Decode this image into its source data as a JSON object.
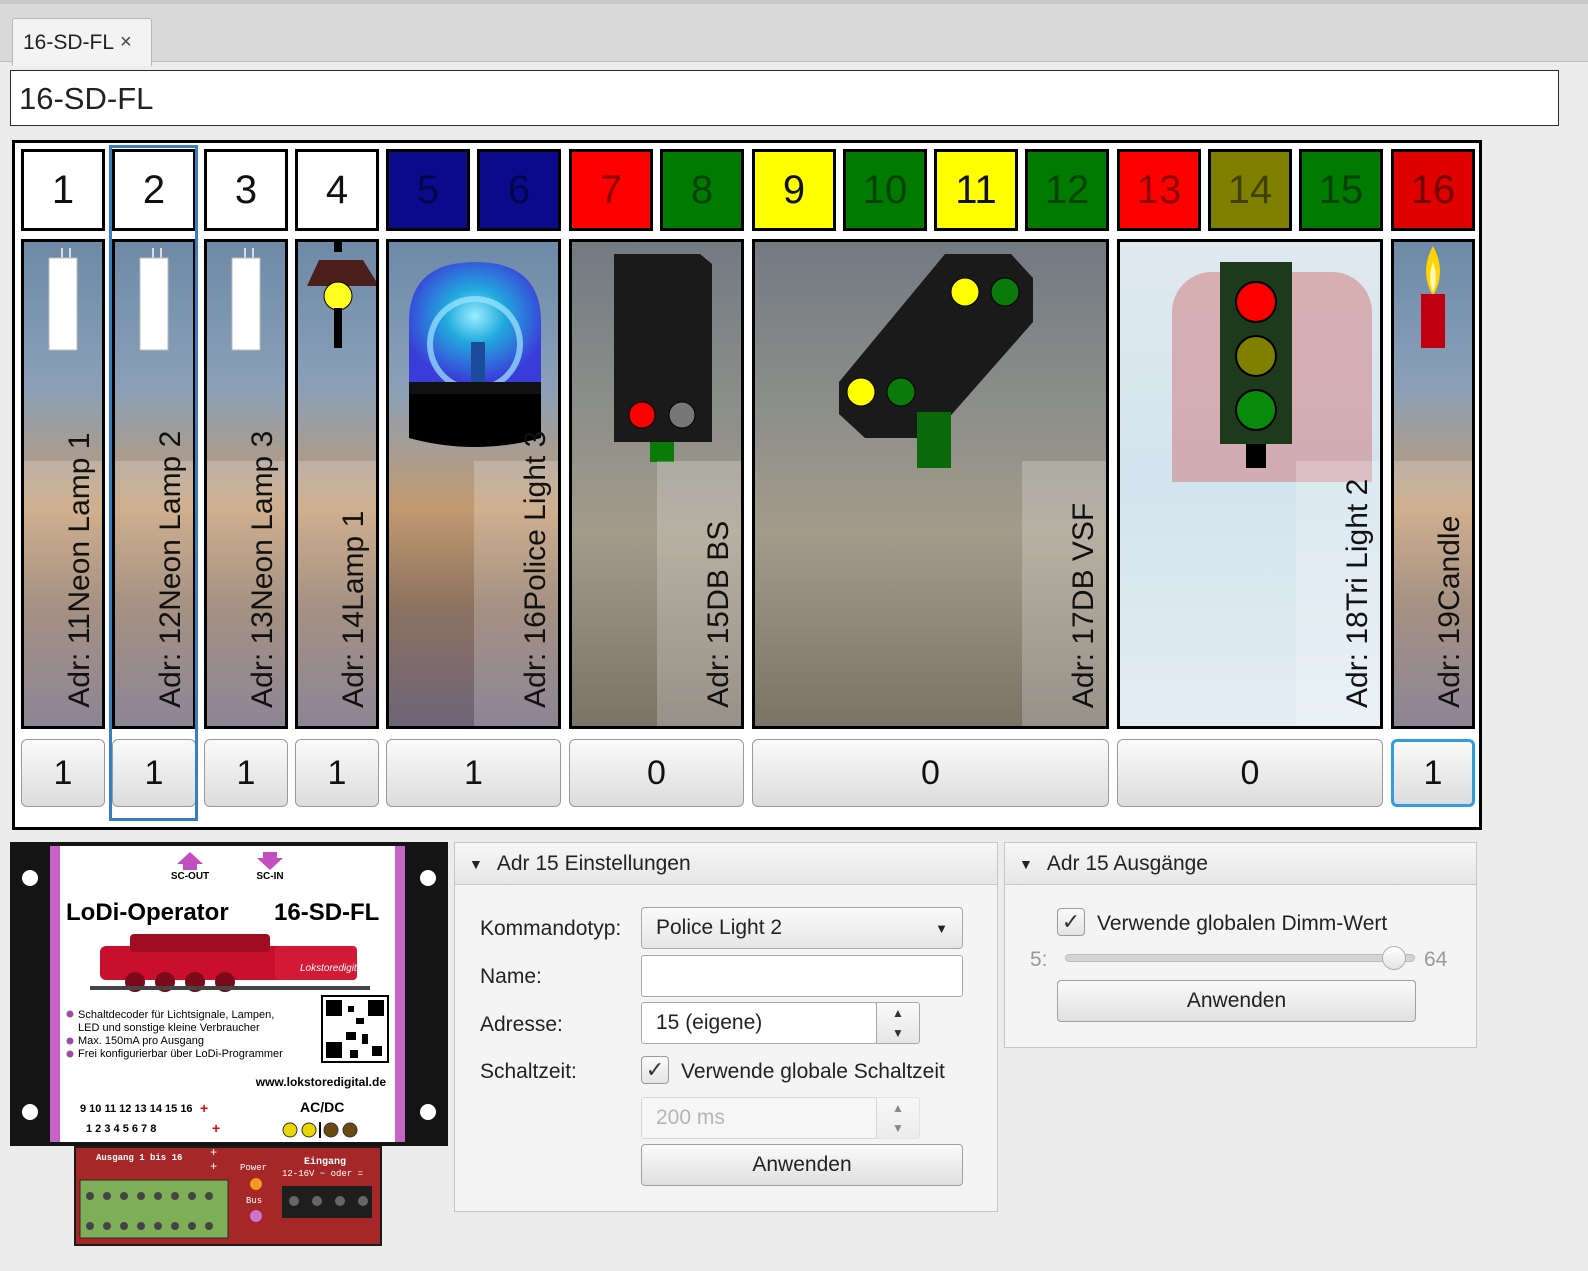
{
  "tab": {
    "label": "16-SD-FL",
    "close": "×"
  },
  "title_value": "16-SD-FL",
  "channels": [
    {
      "n": "1",
      "color": "#ffffff",
      "text": "#111"
    },
    {
      "n": "2",
      "color": "#ffffff",
      "text": "#111"
    },
    {
      "n": "3",
      "color": "#ffffff",
      "text": "#111"
    },
    {
      "n": "4",
      "color": "#ffffff",
      "text": "#111"
    },
    {
      "n": "5",
      "color": "#0a0a8a",
      "text": "rgba(0,0,0,.45)"
    },
    {
      "n": "6",
      "color": "#0a0a8a",
      "text": "rgba(0,0,0,.45)"
    },
    {
      "n": "7",
      "color": "#ff0000",
      "text": "rgba(0,0,0,.45)"
    },
    {
      "n": "8",
      "color": "#007a00",
      "text": "rgba(0,0,0,.45)"
    },
    {
      "n": "9",
      "color": "#ffff00",
      "text": "#111"
    },
    {
      "n": "10",
      "color": "#007a00",
      "text": "rgba(0,0,0,.45)"
    },
    {
      "n": "11",
      "color": "#ffff00",
      "text": "#111"
    },
    {
      "n": "12",
      "color": "#007a00",
      "text": "rgba(0,0,0,.45)"
    },
    {
      "n": "13",
      "color": "#ff0000",
      "text": "rgba(0,0,0,.45)"
    },
    {
      "n": "14",
      "color": "#808000",
      "text": "rgba(0,0,0,.5)"
    },
    {
      "n": "15",
      "color": "#007a00",
      "text": "rgba(0,0,0,.45)"
    },
    {
      "n": "16",
      "color": "#e00000",
      "text": "rgba(0,0,0,.5)"
    }
  ],
  "devices": [
    {
      "name": "Neon Lamp 1",
      "adr": "Adr: 11",
      "value": "1",
      "icon": "neon-tube-icon"
    },
    {
      "name": "Neon Lamp 2",
      "adr": "Adr: 12",
      "value": "1",
      "icon": "neon-tube-icon"
    },
    {
      "name": "Neon Lamp 3",
      "adr": "Adr: 13",
      "value": "1",
      "icon": "neon-tube-icon"
    },
    {
      "name": "Lamp 1",
      "adr": "Adr: 14",
      "value": "1",
      "icon": "street-lamp-icon"
    },
    {
      "name": "Police Light 3",
      "adr": "Adr: 16",
      "value": "1",
      "icon": "blue-beacon-icon"
    },
    {
      "name": "DB BS",
      "adr": "Adr: 15",
      "value": "0",
      "icon": "shunting-signal-icon"
    },
    {
      "name": "DB VSF",
      "adr": "Adr: 17",
      "value": "0",
      "icon": "distant-signal-icon"
    },
    {
      "name": "Tri Light 2",
      "adr": "Adr: 18",
      "value": "0",
      "icon": "traffic-light-icon"
    },
    {
      "name": "Candle",
      "adr": "Adr: 19",
      "value": "1",
      "icon": "candle-icon"
    }
  ],
  "module": {
    "arrow_out": "SC-OUT",
    "arrow_in": "SC-IN",
    "brand": "LoDi-Operator",
    "model": "16-SD-FL",
    "loco_label": "Lokstoredigital",
    "bullets": [
      "Schaltdecoder für Lichtsignale, Lampen,",
      "LED und sonstige kleine Verbraucher",
      "Max. 150mA pro Ausgang",
      "Frei konfigurierbar über LoDi-Programmer"
    ],
    "url": "www.lokstoredigital.de",
    "row1": "9 10 11 12 13 14 15 16",
    "row2": "1 2 3 4 5 6 7 8",
    "plus": "+",
    "acdc": "AC/DC",
    "pcb_outputs": "Ausgang 1 bis 16",
    "pcb_power": "Power",
    "pcb_bus": "Bus",
    "pcb_input": "Eingang",
    "pcb_input2": "12-16V ~ oder ="
  },
  "settings": {
    "header": "Adr 15 Einstellungen",
    "kommandotyp_label": "Kommandotyp:",
    "kommandotyp_value": "Police Light 2",
    "name_label": "Name:",
    "name_value": "",
    "adresse_label": "Adresse:",
    "adresse_value": "15 (eigene)",
    "schaltzeit_label": "Schaltzeit:",
    "schaltzeit_check": "Verwende globale Schaltzeit",
    "schaltzeit_value": "200 ms",
    "apply": "Anwenden"
  },
  "outputs": {
    "header": "Adr 15 Ausgänge",
    "dimm_check": "Verwende globalen Dimm-Wert",
    "slider_min": "5:",
    "slider_max": "64",
    "slider_fraction": 0.97,
    "apply": "Anwenden"
  }
}
